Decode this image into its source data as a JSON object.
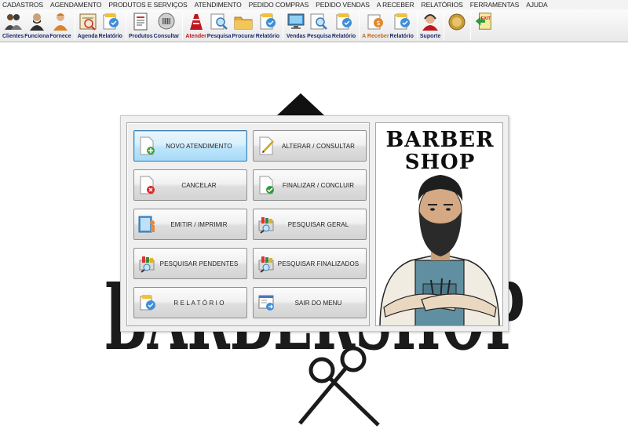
{
  "menubar": {
    "items": [
      "CADASTROS",
      "AGENDAMENTO",
      "PRODUTOS E SERVIÇOS",
      "ATENDIMENTO",
      "PEDIDO COMPRAS",
      "PEDIDO VENDAS",
      "A RECEBER",
      "RELATÓRIOS",
      "FERRAMENTAS",
      "AJUDA"
    ]
  },
  "toolbar": {
    "clientes": "Clientes",
    "funciona": "Funciona",
    "fornece": "Fornece",
    "agenda": "Agenda",
    "relatorio1": "Relatório",
    "produtos": "Produtos",
    "consultar": "Consultar",
    "atender": "Atender",
    "pesquisa1": "Pesquisa",
    "procurar": "Procurar",
    "relatorio2": "Relatório",
    "vendas": "Vendas",
    "pesquisa2": "Pesquisa",
    "relatorio3": "Relatório",
    "areceber": "A Receber",
    "relatorio4": "Relatório",
    "suporte": "Suporte",
    "exit_text": "EXIT"
  },
  "dialog": {
    "buttons": {
      "novo": "NOVO ATENDIMENTO",
      "alterar": "ALTERAR  /  CONSULTAR",
      "cancelar": "CANCELAR",
      "finalizar": "FINALIZAR  /  CONCLUIR",
      "emitir": "EMITIR  /  IMPRIMIR",
      "pesq_geral": "PESQUISAR GERAL",
      "pesq_pend": "PESQUISAR PENDENTES",
      "pesq_final": "PESQUISAR FINALIZADOS",
      "relatorio": "R E L A T Ó R I O",
      "sair": "SAIR DO MENU"
    },
    "image_title_line1": "BARBER",
    "image_title_line2": "SHOP"
  },
  "background": {
    "logo_text": "BARBERSHOP"
  },
  "colors": {
    "focus_border": "#3c7fb1",
    "label_blue": "#1a2b6a",
    "label_red": "#c0141e",
    "label_orange": "#c4661a"
  }
}
